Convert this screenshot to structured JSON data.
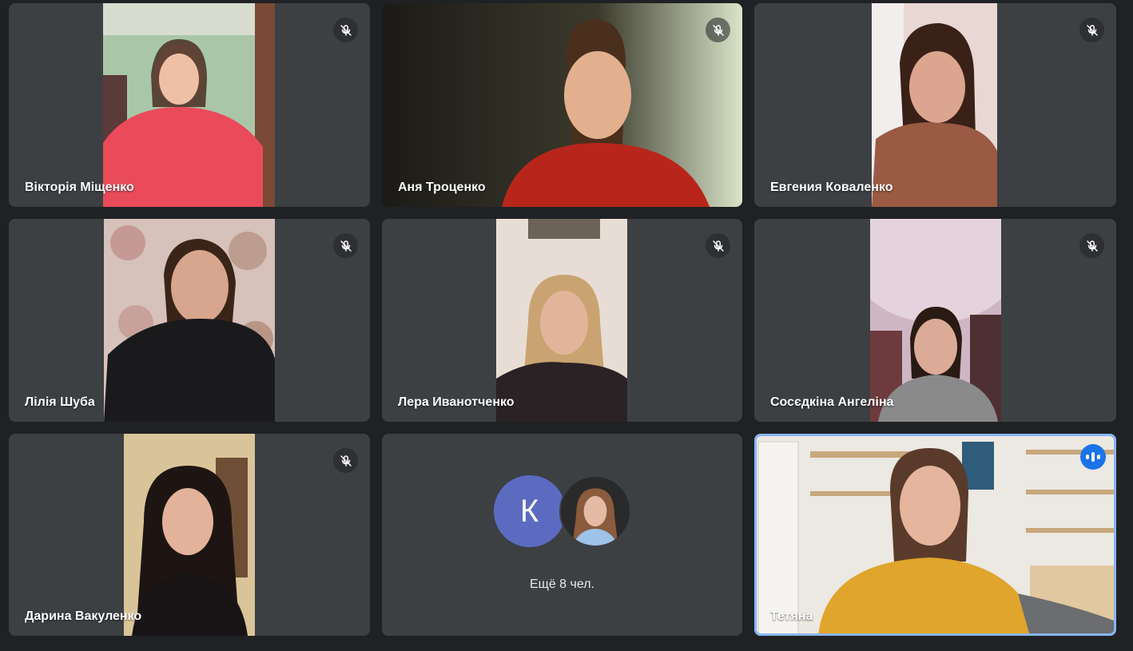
{
  "participants": [
    {
      "name": "Вікторія Міщенко",
      "muted": true
    },
    {
      "name": "Аня Троценко",
      "muted": true
    },
    {
      "name": "Евгения Коваленко",
      "muted": true
    },
    {
      "name": "Лілія Шуба",
      "muted": true
    },
    {
      "name": "Лера Иванотченко",
      "muted": true
    },
    {
      "name": "Сосєдкіна Ангеліна",
      "muted": true
    },
    {
      "name": "Дарина Вакуленко",
      "muted": true
    }
  ],
  "others": {
    "avatar_initial": "К",
    "avatar_color": "#5c6bc0",
    "label": "Ещё 8 чел."
  },
  "active_speaker": {
    "name": "Тетяна",
    "indicator_icon": "speaking-indicator-icon",
    "accent": "#8ab4f8"
  },
  "icons": {
    "muted": "mic-off-icon"
  }
}
